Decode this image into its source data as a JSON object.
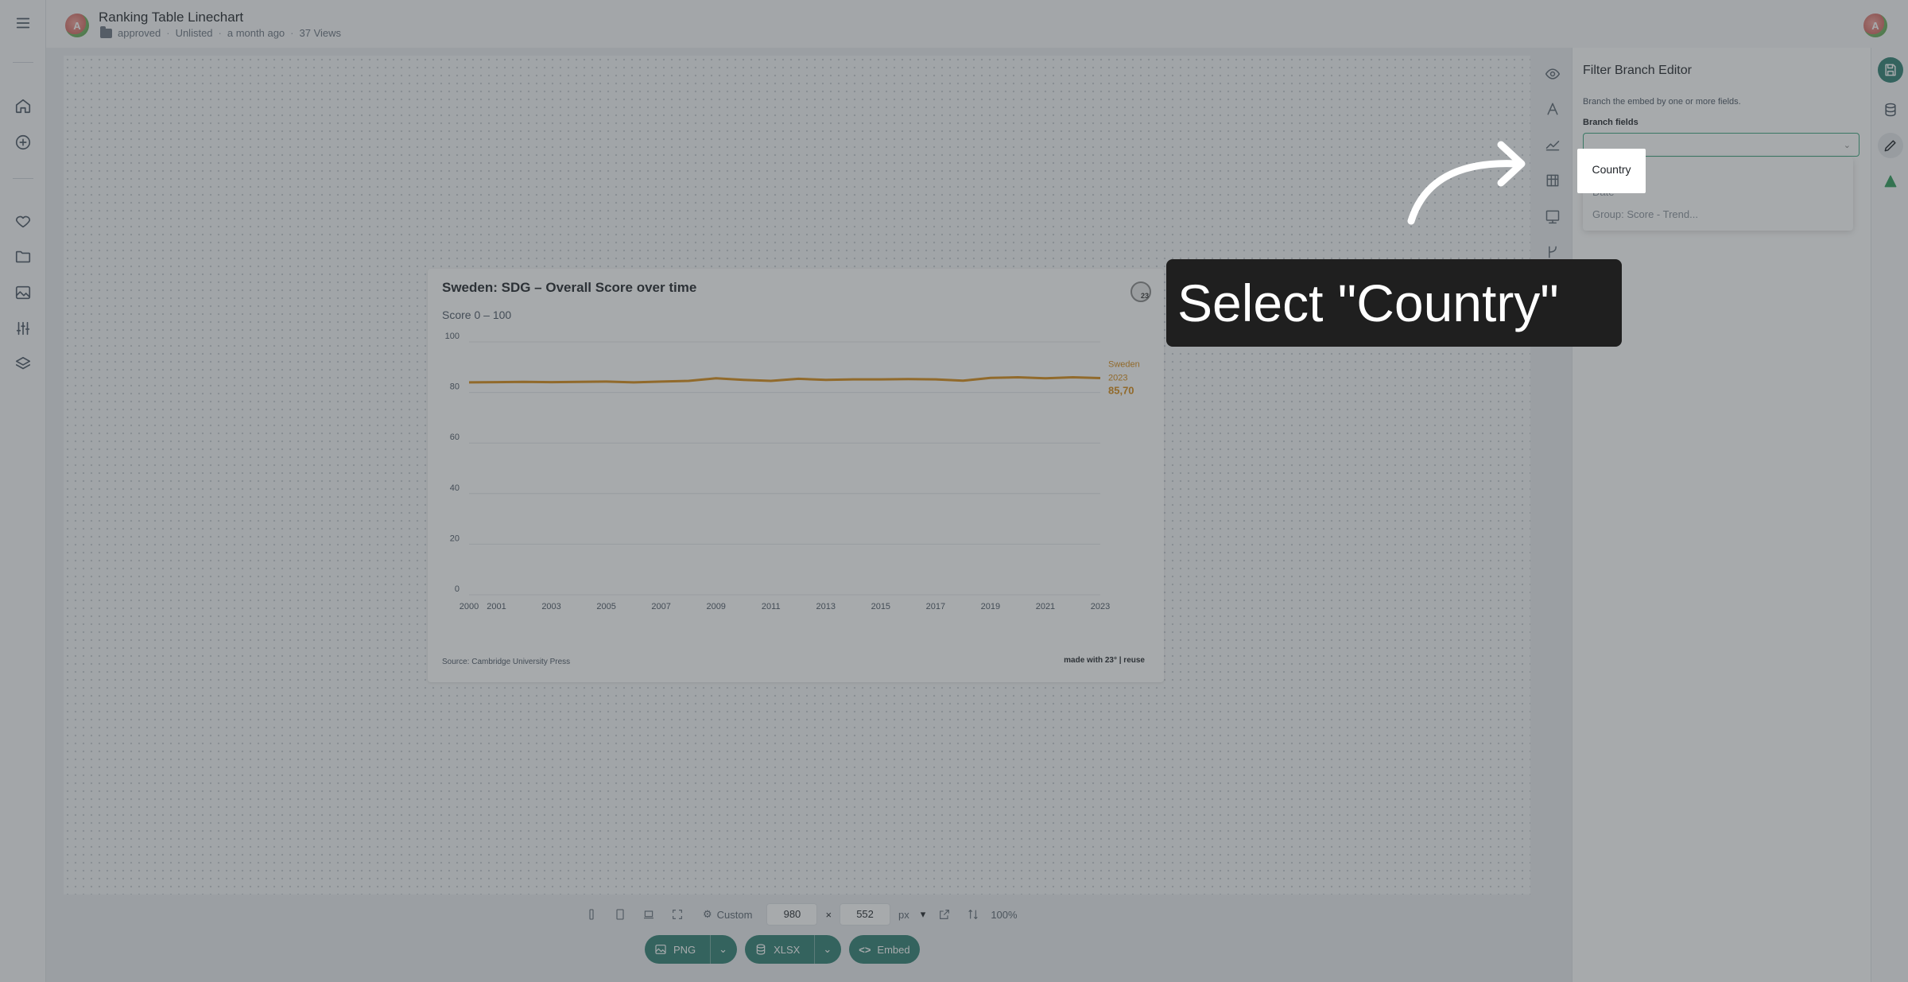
{
  "header": {
    "avatar_letter": "A",
    "title": "Ranking Table Linechart",
    "meta": {
      "folder": "approved",
      "visibility": "Unlisted",
      "time": "a month ago",
      "views": "37 Views"
    }
  },
  "leftrail": {
    "items": [
      "menu-icon",
      "home-icon",
      "plus-circle-icon",
      "heart-icon",
      "folder-icon",
      "image-icon",
      "sliders-icon",
      "layers-icon"
    ]
  },
  "chart_card": {
    "title": "Sweden: SDG – Overall Score over time",
    "subtitle": "Score 0 – 100",
    "logo": "23",
    "source": "Source: Cambridge University Press",
    "made_with": "made with 23° | reuse",
    "end_label": {
      "series": "Sweden",
      "year": "2023",
      "value": "85,70"
    }
  },
  "chart_data": {
    "type": "line",
    "title": "Sweden: SDG – Overall Score over time",
    "subtitle": "Score 0 – 100",
    "ylim": [
      0,
      100
    ],
    "y_ticks": [
      "100",
      "80",
      "60",
      "40",
      "20",
      "0"
    ],
    "x_ticks": [
      "2000",
      "2001",
      "2003",
      "2005",
      "2007",
      "2009",
      "2011",
      "2013",
      "2015",
      "2017",
      "2019",
      "2021",
      "2023"
    ],
    "series": [
      {
        "name": "Sweden",
        "color": "#d88a14",
        "x": [
          2000,
          2001,
          2002,
          2003,
          2004,
          2005,
          2006,
          2007,
          2008,
          2009,
          2010,
          2011,
          2012,
          2013,
          2014,
          2015,
          2016,
          2017,
          2018,
          2019,
          2020,
          2021,
          2022,
          2023
        ],
        "y": [
          84.0,
          84.1,
          84.2,
          84.1,
          84.2,
          84.3,
          84.0,
          84.3,
          84.6,
          85.6,
          85.0,
          84.6,
          85.4,
          85.0,
          85.2,
          85.2,
          85.3,
          85.2,
          84.7,
          85.8,
          86.0,
          85.6,
          86.0,
          85.7
        ]
      }
    ],
    "grid": true,
    "legend": "end-label"
  },
  "toolbar_icons": [
    "eye-icon",
    "text-icon",
    "chart-line-icon",
    "grid-icon",
    "image-frame-icon",
    "branch-icon",
    "chat-icon"
  ],
  "panel": {
    "title": "Filter Branch Editor",
    "description": "Branch the embed by one or more fields.",
    "field_label": "Branch fields",
    "select_value": "",
    "options": [
      "Country",
      "Date",
      "Group: Score - Trend..."
    ]
  },
  "far_rail": [
    "save-icon",
    "database-icon",
    "pencil-icon",
    "triangle-icon"
  ],
  "bottom": {
    "size_mode": "Custom",
    "width": "980",
    "times": "×",
    "height": "552",
    "unit": "px",
    "zoom": "100%"
  },
  "export": {
    "png": "PNG",
    "xlsx": "XLSX",
    "embed": "Embed"
  },
  "tooltip": {
    "text": "Select \"Country\""
  },
  "colors": {
    "accent": "#2e7f72",
    "line": "#d88a14",
    "select_border": "#3aa57c"
  }
}
